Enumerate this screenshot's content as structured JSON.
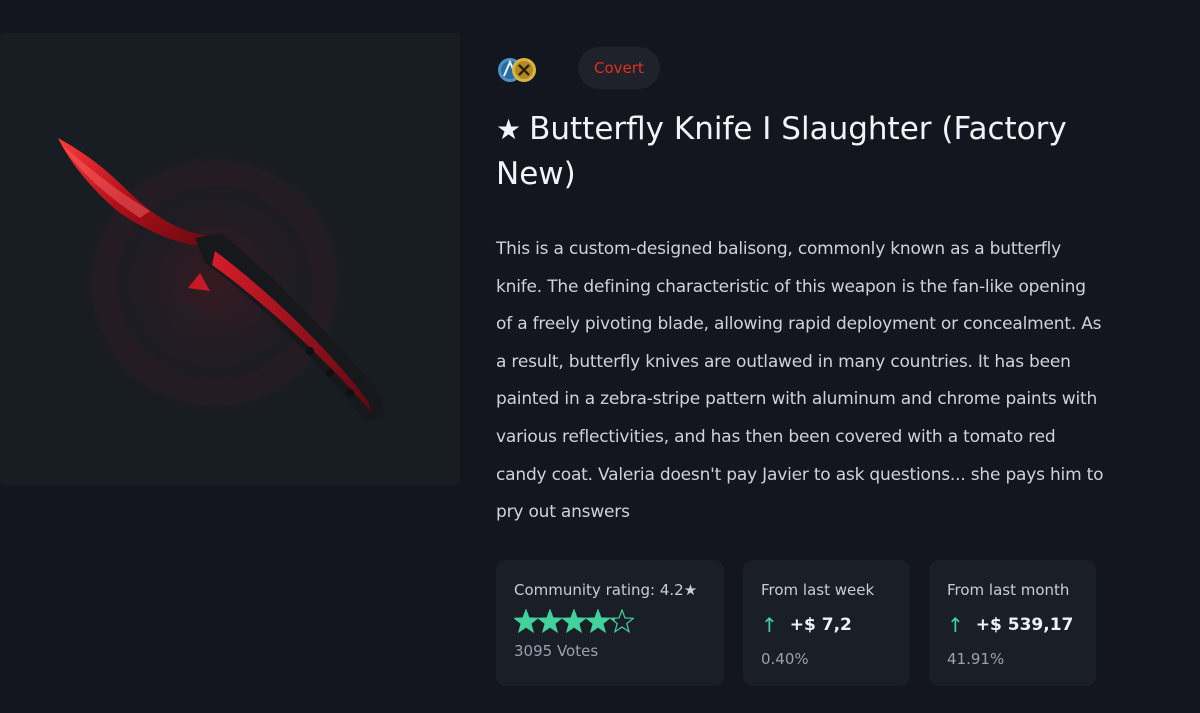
{
  "item": {
    "rarity": "Covert",
    "title_star": "★",
    "title": "Butterfly Knife I Slaughter (Factory New)",
    "description": "This is a custom-designed balisong, commonly known as a butterfly knife. The defining characteristic of this weapon is the fan-like opening of a freely pivoting blade, allowing rapid deployment or concealment. As a result, butterfly knives are outlawed in many countries. It has been painted in a zebra-stripe pattern with aluminum and chrome paints with various reflectivities, and has then been covered with a tomato red candy coat. Valeria doesn't pay Javier to ask questions... she pays him to pry out answers"
  },
  "stats": {
    "rating": {
      "label": "Community rating: 4.2★",
      "value": 4.2,
      "max": 5,
      "votes": "3095 Votes"
    },
    "week": {
      "label": "From last week",
      "arrow": "↑",
      "change": "+$ 7,2",
      "percent": "0.40%"
    },
    "month": {
      "label": "From last month",
      "arrow": "↑",
      "change": "+$ 539,17",
      "percent": "41.91%"
    }
  },
  "colors": {
    "background": "#13161f",
    "rarity_red": "#e0301e",
    "accent_green": "#41d39b"
  }
}
